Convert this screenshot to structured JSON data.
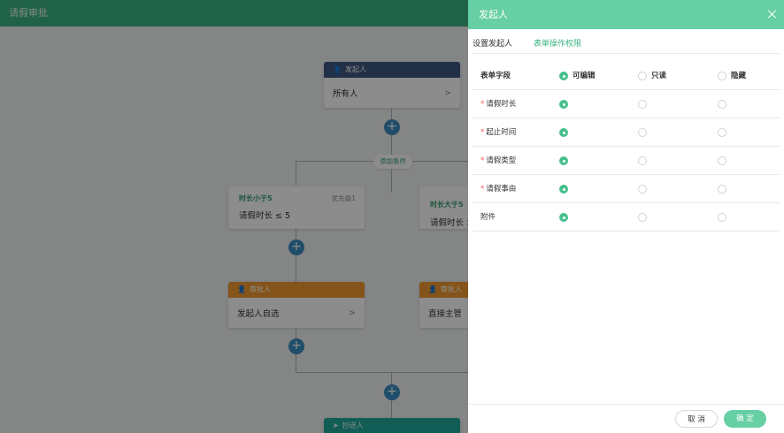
{
  "app": {
    "title": "请假审批"
  },
  "flow": {
    "initiator": {
      "header": "发起人",
      "value": "所有人"
    },
    "add_condition": "添加条件",
    "conditions": [
      {
        "label": "时长小于5",
        "priority": "优先级1",
        "value": "请假时长 ≤ 5"
      },
      {
        "label": "时长大于5",
        "value": "请假时长 >"
      }
    ],
    "approvers": [
      {
        "header": "审批人",
        "value": "发起人自选"
      },
      {
        "header": "审批人",
        "value": "直接主管"
      }
    ],
    "cc": {
      "header": "抄送人"
    }
  },
  "drawer": {
    "title": "发起人",
    "tabs": [
      {
        "label": "设置发起人"
      },
      {
        "label": "表单操作权限"
      }
    ],
    "table": {
      "headers": {
        "field": "表单字段",
        "editable": "可编辑",
        "readonly": "只读",
        "hidden": "隐藏"
      },
      "rows": [
        {
          "label": "请假时长",
          "required": true,
          "selected": "editable"
        },
        {
          "label": "起止时间",
          "required": true,
          "selected": "editable"
        },
        {
          "label": "请假类型",
          "required": true,
          "selected": "editable"
        },
        {
          "label": "请假事由",
          "required": true,
          "selected": "editable"
        },
        {
          "label": "附件",
          "required": false,
          "selected": "editable"
        }
      ],
      "required_mark": "*"
    },
    "buttons": {
      "cancel": "取 消",
      "ok": "确 定"
    }
  },
  "colors": {
    "accent": "#66cfa3",
    "header": "#3bb383",
    "initiator": "#3f5882",
    "approver": "#f29a31",
    "cc": "#21a99b"
  }
}
